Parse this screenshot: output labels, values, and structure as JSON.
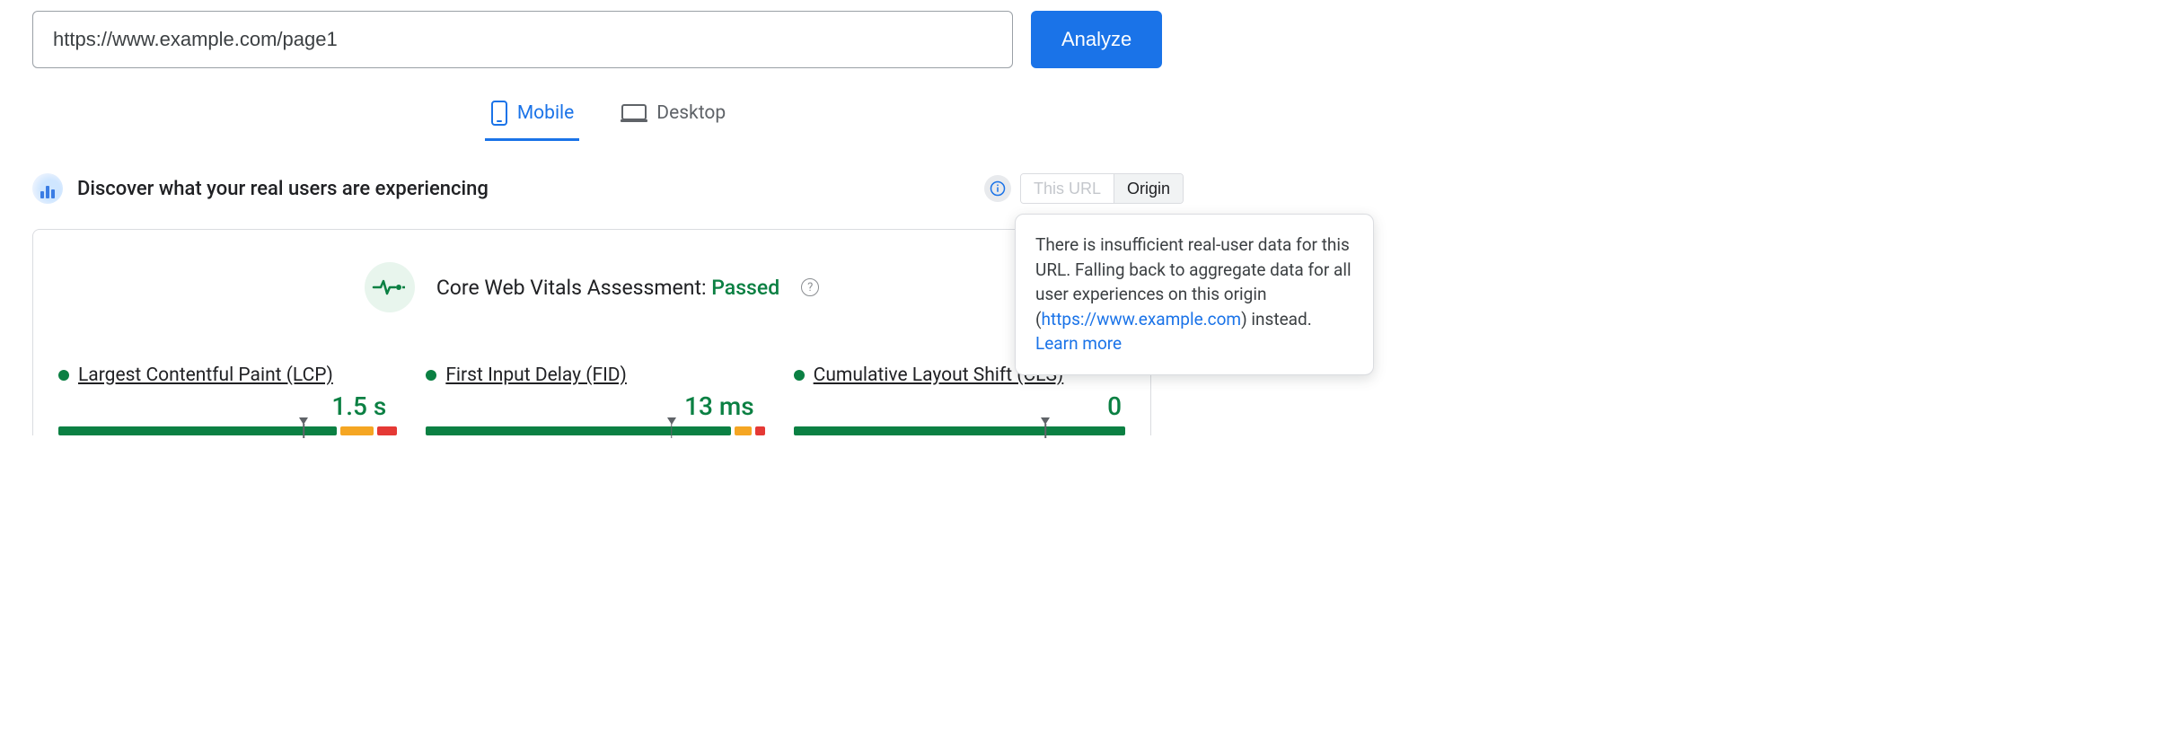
{
  "url_input": {
    "value": "https://www.example.com/page1"
  },
  "analyze_label": "Analyze",
  "tabs": {
    "mobile": "Mobile",
    "desktop": "Desktop"
  },
  "discover": {
    "title": "Discover what your real users are experiencing"
  },
  "scope": {
    "this_url": "This URL",
    "origin": "Origin"
  },
  "assessment": {
    "prefix": "Core Web Vitals Assessment: ",
    "status": "Passed"
  },
  "metrics": {
    "lcp": {
      "name": "Largest Contentful Paint (LCP)",
      "value": "1.5 s",
      "good_pct": 84,
      "ni_pct": 10,
      "poor_pct": 6,
      "marker_pct": 74
    },
    "fid": {
      "name": "First Input Delay (FID)",
      "value": "13 ms",
      "good_pct": 92,
      "ni_pct": 5,
      "poor_pct": 3,
      "marker_pct": 74
    },
    "cls": {
      "name": "Cumulative Layout Shift (CLS)",
      "value": "0",
      "good_pct": 100,
      "ni_pct": 0,
      "poor_pct": 0,
      "marker_pct": 76
    }
  },
  "tooltip": {
    "t1": "There is insufficient real-user data for this URL. Falling back to aggregate data for all user experiences on this origin (",
    "link": "https://www.example.com",
    "t2": ") instead. ",
    "learn": "Learn more"
  }
}
